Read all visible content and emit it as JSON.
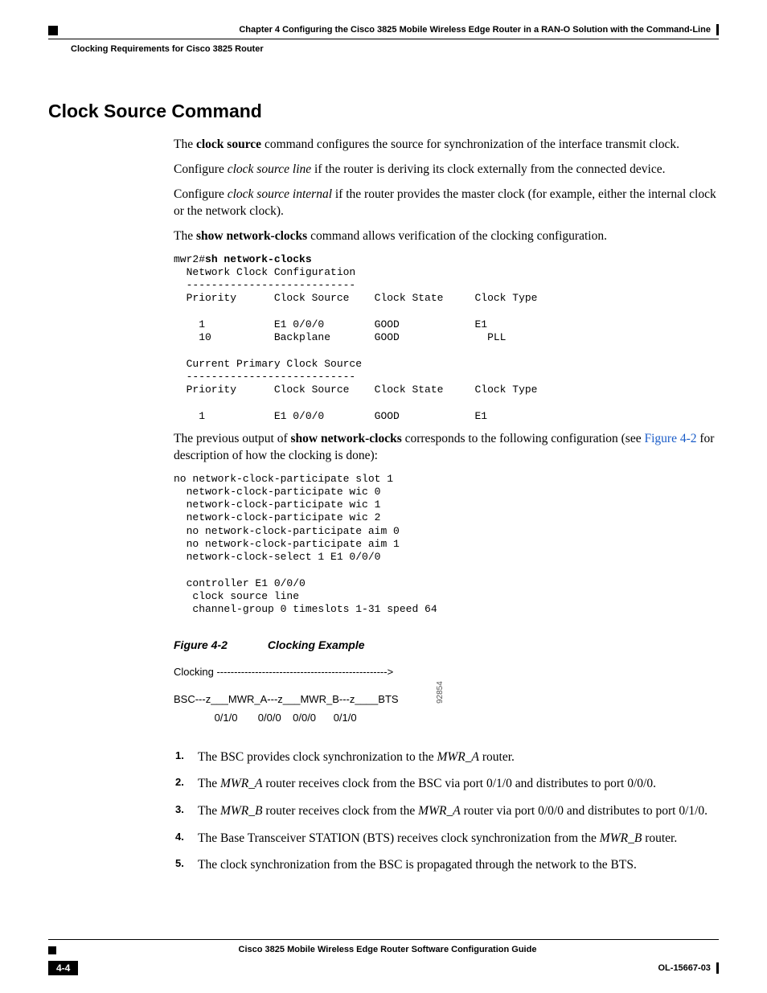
{
  "header": {
    "chapter": "Chapter 4      Configuring the Cisco 3825 Mobile Wireless Edge Router in a RAN-O Solution with the Command-Line",
    "section": "Clocking Requirements for Cisco 3825 Router"
  },
  "heading": "Clock Source Command",
  "para1_pre": "The ",
  "para1_bold": "clock source",
  "para1_post": " command configures the source for synchronization of the interface transmit clock.",
  "para2_pre": "Configure ",
  "para2_it": "clock source line",
  "para2_post": " if the router is deriving its clock externally from the connected device.",
  "para3_pre": "Configure ",
  "para3_it": "clock source internal",
  "para3_post": " if the router provides the master clock (for example, either the internal clock or the network clock).",
  "para4_pre": "The ",
  "para4_bold": "show network-clocks",
  "para4_post": " command allows verification of the clocking configuration.",
  "cli1_prompt": "mwr2#",
  "cli1_cmd": "sh network-clocks",
  "cli1_body": "  Network Clock Configuration\n  ---------------------------\n  Priority      Clock Source    Clock State     Clock Type\n\n    1           E1 0/0/0        GOOD            E1 \n    10          Backplane       GOOD              PLL  \n\n  Current Primary Clock Source\n  ---------------------------\n  Priority      Clock Source    Clock State     Clock Type\n\n    1           E1 0/0/0        GOOD            E1 ",
  "para5_pre": "The previous output of ",
  "para5_bold": "show network-clocks",
  "para5_mid": " corresponds to the following configuration (see ",
  "para5_link": "Figure 4-2",
  "para5_post": " for description of how the clocking is done):",
  "cli2": "no network-clock-participate slot 1\n  network-clock-participate wic 0\n  network-clock-participate wic 1\n  network-clock-participate wic 2\n  no network-clock-participate aim 0\n  no network-clock-participate aim 1\n  network-clock-select 1 E1 0/0/0\n\n  controller E1 0/0/0\n   clock source line\n   channel-group 0 timeslots 1-31 speed 64",
  "fig": {
    "num": "Figure 4-2",
    "title": "Clocking Example",
    "line1": "Clocking ------------------------------------------------->",
    "line2": " BSC---z___MWR_A---z___MWR_B---z____BTS",
    "line3": "              0/1/0       0/0/0    0/0/0      0/1/0",
    "id": "92854"
  },
  "steps": [
    {
      "pre": "The BSC provides clock synchronization to the ",
      "it": "MWR_A",
      "post": " router."
    },
    {
      "pre": "The ",
      "it": "MWR_A",
      "post": " router receives clock from the BSC via port 0/1/0 and distributes to port 0/0/0."
    },
    {
      "pre": "The ",
      "it": "MWR_B",
      "mid": " router receives clock from the ",
      "it2": "MWR_A",
      "post": " router via port 0/0/0 and distributes to port 0/1/0."
    },
    {
      "pre": "The Base Transceiver STATION (BTS) receives clock synchronization from the ",
      "it": "MWR_B",
      "post": " router."
    },
    {
      "pre": "The clock synchronization from the BSC is propagated through the network to the BTS.",
      "it": "",
      "post": ""
    }
  ],
  "footer": {
    "guide": "Cisco 3825 Mobile Wireless Edge Router Software Configuration Guide",
    "page": "4-4",
    "doc": "OL-15667-03"
  }
}
